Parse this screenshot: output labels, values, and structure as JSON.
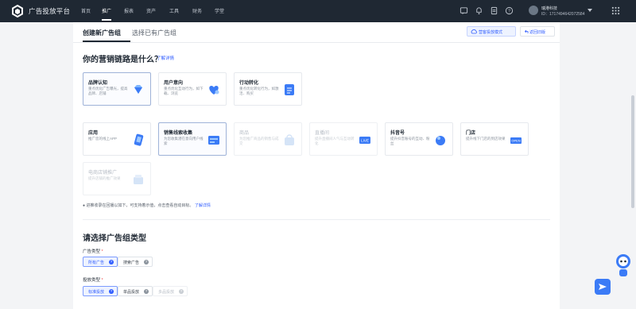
{
  "topbar": {
    "app_title": "广告投放平台",
    "nav": [
      "首页",
      "推广",
      "报表",
      "资产",
      "工具",
      "财务",
      "学堂"
    ],
    "active_nav": "推广",
    "user_name": "瑞港科技",
    "user_id": "ID：1717494642072584"
  },
  "tabs": {
    "create": "创建新广告组",
    "existing": "选择已有广告组"
  },
  "buttons": {
    "mode": "营客投放模式",
    "back": "返回旧版"
  },
  "marketing": {
    "title": "你的营销链路是什么？",
    "learn_more": "了解详情",
    "cards": [
      {
        "title": "品牌认知",
        "desc": "重点优化广告曝光，提高品牌、店铺",
        "state": "selected",
        "icon": "diamond-icon"
      },
      {
        "title": "用户意向",
        "desc": "重点优化互动行为，如下载、浏览",
        "state": "normal",
        "icon": "heart-icon"
      },
      {
        "title": "行动转化",
        "desc": "重点优化转化行为，如激活、购买",
        "state": "normal",
        "icon": "document-icon"
      },
      {
        "title": "应用",
        "desc": "推广您的线上APP",
        "state": "normal",
        "icon": "phone-icon"
      },
      {
        "title": "销售线索收集",
        "desc": "为您收集潜在意向用户线索",
        "state": "selected",
        "icon": "form-icon"
      },
      {
        "title": "商品",
        "desc": "为您推广商品的销售与成交",
        "state": "disabled",
        "icon": "bag-icon"
      },
      {
        "title": "直播间",
        "desc": "提升直播间人气与互动转化",
        "state": "disabled",
        "icon": "live-icon"
      },
      {
        "title": "抖音号",
        "desc": "提升抖音账号的互动、粉丝",
        "state": "normal",
        "icon": "tiktok-icon"
      },
      {
        "title": "门店",
        "desc": "提升线下门店的到店效果",
        "state": "normal",
        "icon": "store-icon"
      },
      {
        "title": "电商店铺推广",
        "desc": "提升店铺的推广效果",
        "state": "disabled",
        "icon": "shop-icon"
      }
    ],
    "hint": "● 进推收录在回播以如下，可支持着示值，点击查看自动目标。",
    "hint_link": "了解详情"
  },
  "ad_group_type": {
    "title": "请选择广告组类型",
    "ad_type_label": "广告类型",
    "ad_type_options": [
      {
        "label": "所有广告",
        "state": "active"
      },
      {
        "label": "搜索广告",
        "state": "normal"
      }
    ],
    "delivery_label": "投放类型",
    "delivery_options": [
      {
        "label": "标准投放",
        "state": "active"
      },
      {
        "label": "单品投放",
        "state": "normal"
      },
      {
        "label": "多品投放",
        "state": "disabled"
      }
    ]
  },
  "colors": {
    "topbar": "#1f2833",
    "accent": "#2f5cff",
    "selected_border": "#9fb3d8"
  }
}
